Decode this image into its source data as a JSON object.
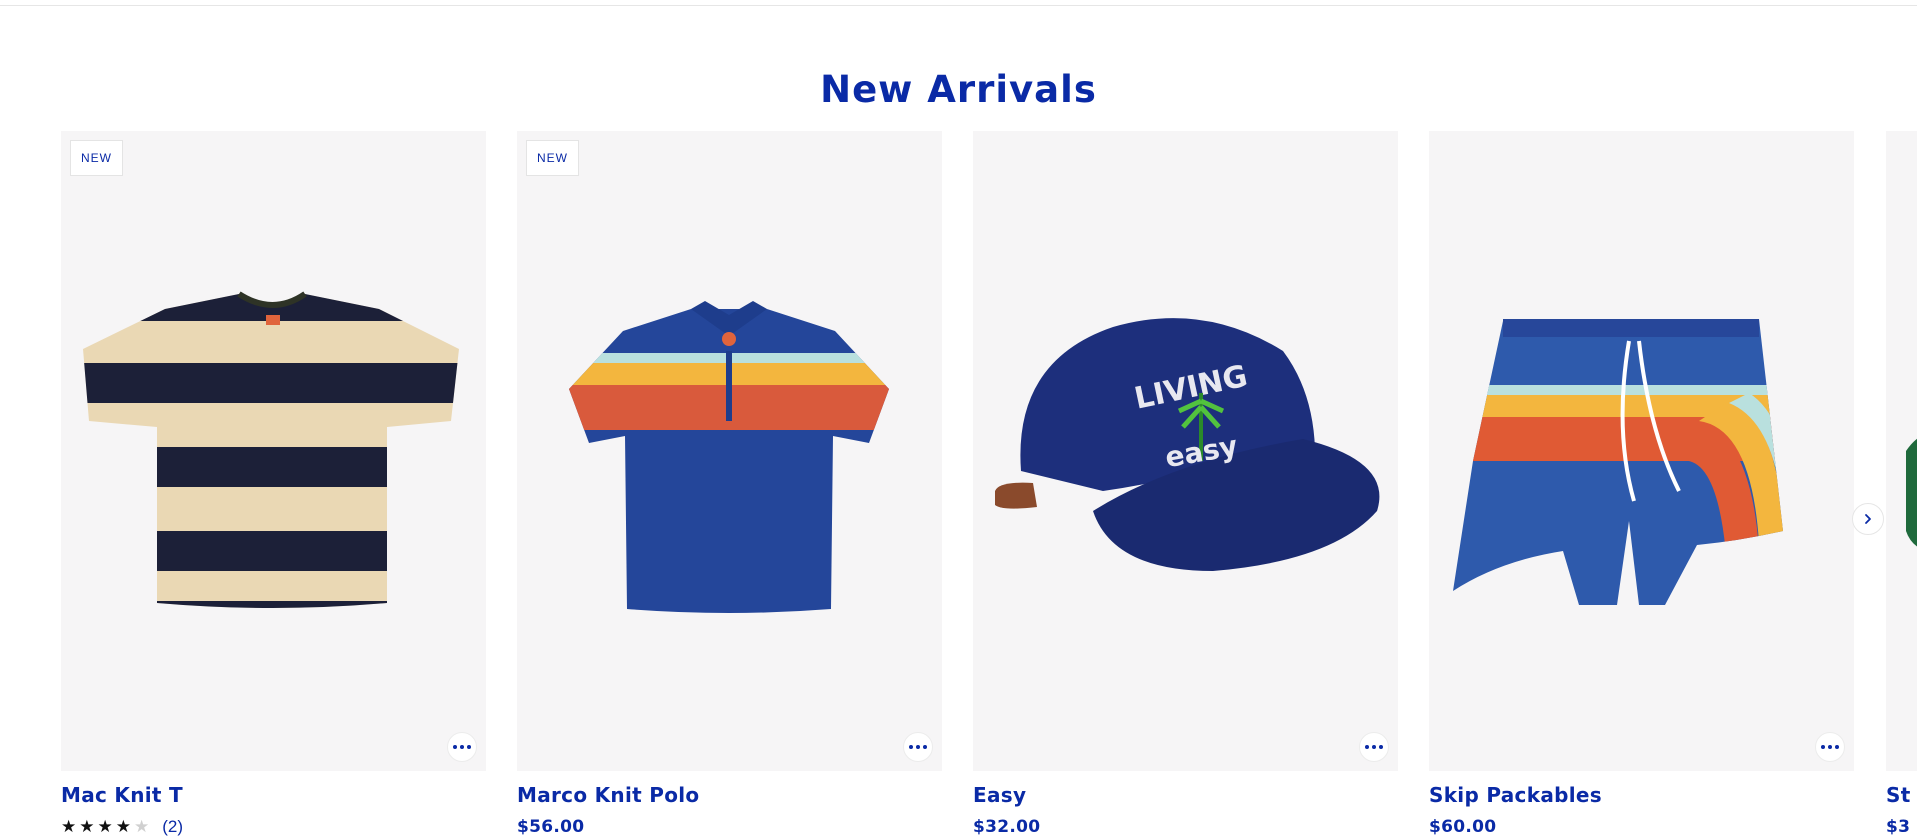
{
  "section": {
    "title": "New Arrivals"
  },
  "colors": {
    "brand": "#0a2aa6",
    "card_bg": "#f6f5f6",
    "navy": "#1f2f6e",
    "cream": "#ead8b4"
  },
  "products": [
    {
      "name": "Mac Knit T",
      "badge": "NEW",
      "rating": {
        "stars_filled": 4,
        "stars_total": 5,
        "count_label": "(2)"
      },
      "image_icon": "striped-tshirt-icon"
    },
    {
      "name": "Marco Knit Polo",
      "badge": "NEW",
      "price": "$56.00",
      "image_icon": "striped-polo-icon"
    },
    {
      "name": "Easy",
      "price": "$32.00",
      "image_icon": "living-easy-cap-icon",
      "cap_text_top": "LIVING",
      "cap_text_bottom": "easy"
    },
    {
      "name": "Skip Packables",
      "price": "$60.00",
      "image_icon": "striped-swim-shorts-icon"
    },
    {
      "name": "St",
      "price": "$3",
      "image_icon": "green-garment-icon"
    }
  ],
  "carousel": {
    "next_icon": "chevron-right-icon"
  }
}
